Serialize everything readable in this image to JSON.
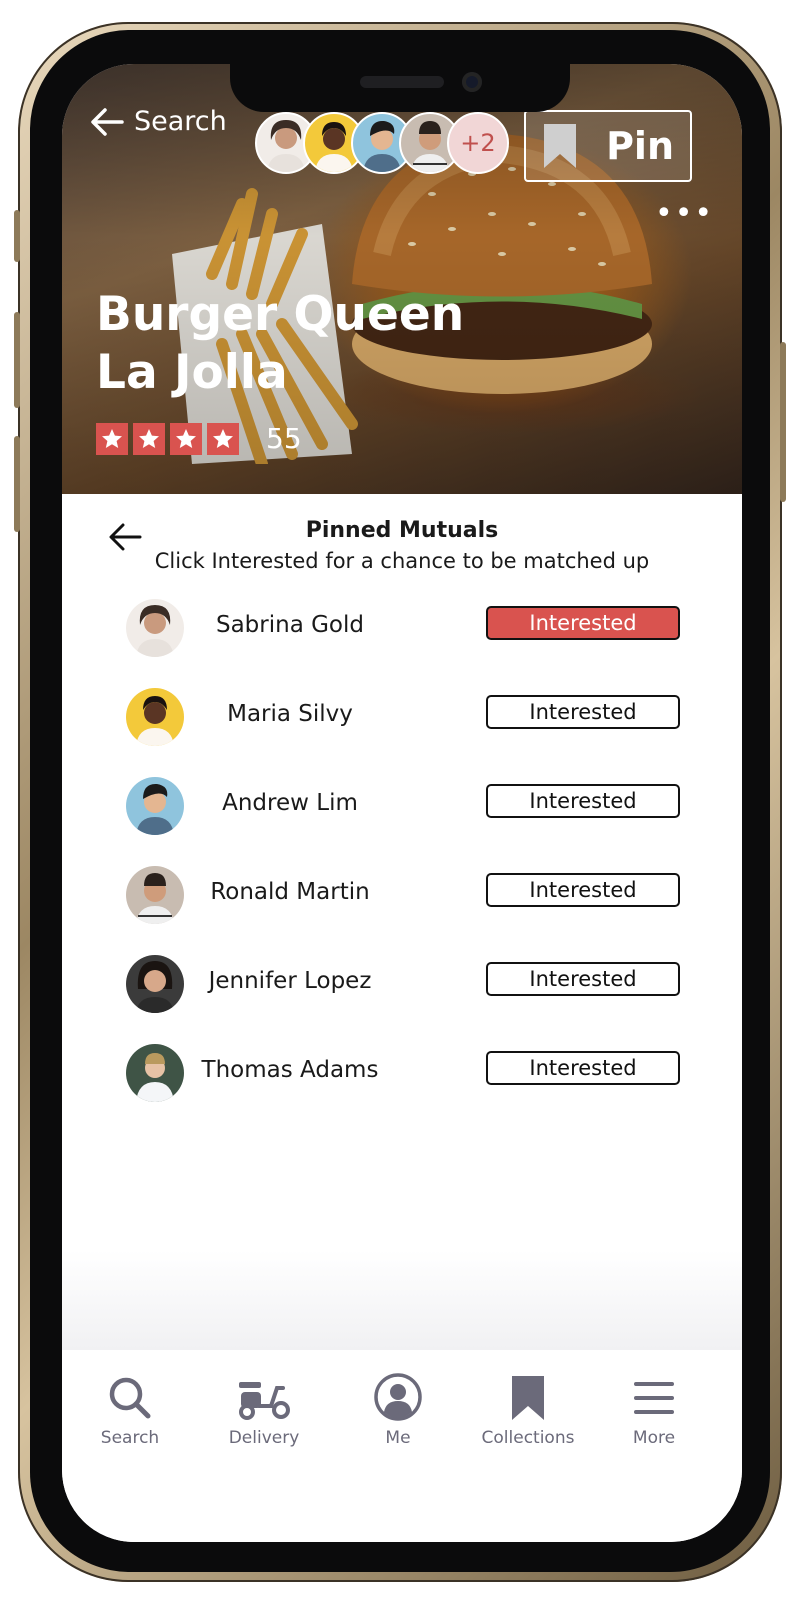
{
  "header": {
    "back_label": "Search",
    "more_count": "+2",
    "pin_label": "Pin",
    "more_menu": "•••"
  },
  "restaurant": {
    "name_line1": "Burger Queen",
    "name_line2": "La Jolla",
    "stars": 4,
    "review_count": "55"
  },
  "panel": {
    "title": "Pinned Mutuals",
    "subtitle": "Click Interested for a chance to be matched up",
    "rows": [
      {
        "name": "Sabrina Gold",
        "button": "Interested",
        "active": true
      },
      {
        "name": "Maria Silvy",
        "button": "Interested",
        "active": false
      },
      {
        "name": "Andrew Lim",
        "button": "Interested",
        "active": false
      },
      {
        "name": "Ronald Martin",
        "button": "Interested",
        "active": false
      },
      {
        "name": "Jennifer Lopez",
        "button": "Interested",
        "active": false
      },
      {
        "name": "Thomas Adams",
        "button": "Interested",
        "active": false
      }
    ]
  },
  "tabs": [
    {
      "label": "Search",
      "icon": "search-icon"
    },
    {
      "label": "Delivery",
      "icon": "scooter-icon"
    },
    {
      "label": "Me",
      "icon": "profile-icon"
    },
    {
      "label": "Collections",
      "icon": "bookmark-icon"
    },
    {
      "label": "More",
      "icon": "menu-icon"
    }
  ],
  "colors": {
    "accent": "#d9534f",
    "tab_icon": "#6b6a7a"
  }
}
